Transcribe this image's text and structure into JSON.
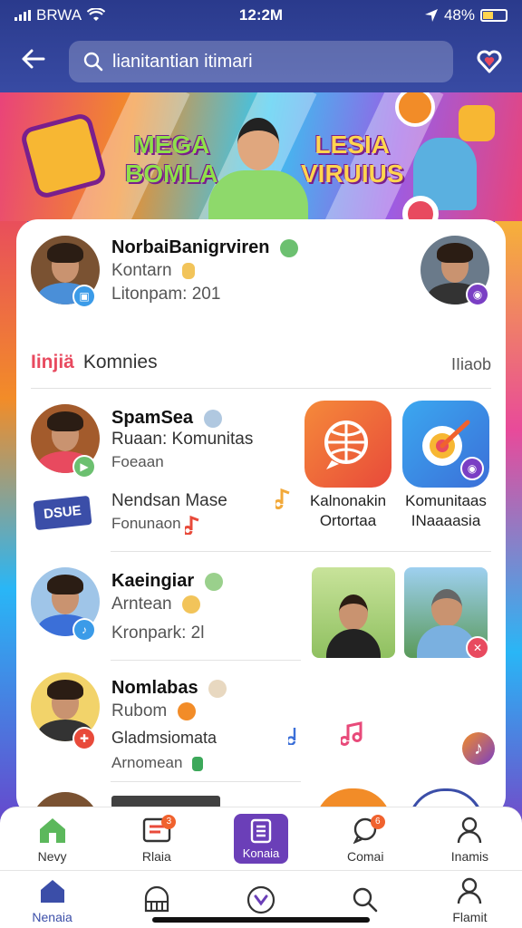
{
  "status_bar": {
    "carrier": "BRWA",
    "time": "12:2M",
    "battery": "48%"
  },
  "header": {
    "search_text": "lianitantian itimari"
  },
  "banner": {
    "left_title_1": "MEGA",
    "left_title_2": "BOMLA",
    "right_title_1": "LESIA",
    "right_title_2": "VIRUIUS"
  },
  "profile": {
    "name": "NorbaiBanigrviren",
    "line1": "Kontarn",
    "line2": "Litonpam: 201"
  },
  "section": {
    "logo": "Iinjiä",
    "title": "Komnies",
    "more": "IIiaob"
  },
  "items": [
    {
      "name": "SpamSea",
      "line1": "Ruaan: Komunitas",
      "line2": "Foeaan"
    },
    {
      "name": "Kaeingiar",
      "line1": "Arntean",
      "line2": "Kronpark: 2l"
    },
    {
      "name": "Nomlabas",
      "line1": "Rubom",
      "line2": "Gladmsiomata",
      "line3": "Arnomean"
    }
  ],
  "promo": {
    "logo_text": "DSUE",
    "line1": "Nendsan Mase",
    "line2": "Fonunaon"
  },
  "apps": [
    {
      "label_1": "Kalnonakin",
      "label_2": "Ortortaa",
      "color": "#f0622e"
    },
    {
      "label_1": "Komunitaas",
      "label_2": "INaaaasia",
      "color": "#3b8fe8"
    }
  ],
  "tabbar_top": [
    {
      "label": "Nevy",
      "icon": "house-icon"
    },
    {
      "label": "Rlaia",
      "icon": "news-icon",
      "badge": "3"
    },
    {
      "label": "Konaia",
      "icon": "list-icon",
      "active": true
    },
    {
      "label": "Comai",
      "icon": "chat-icon",
      "badge": "6"
    },
    {
      "label": "Inamis",
      "icon": "person-icon"
    }
  ],
  "tabbar_bottom": [
    {
      "label": "Nenaia",
      "icon": "home-icon",
      "active": true
    },
    {
      "label": "",
      "icon": "store-icon"
    },
    {
      "label": "",
      "icon": "heart-circle-icon"
    },
    {
      "label": "",
      "icon": "search-icon"
    },
    {
      "label": "Flamit",
      "icon": "profile-icon"
    }
  ],
  "colors": {
    "accent": "#6b3fb8",
    "home_active": "#3b4ea8",
    "badge": "#f0622e"
  }
}
